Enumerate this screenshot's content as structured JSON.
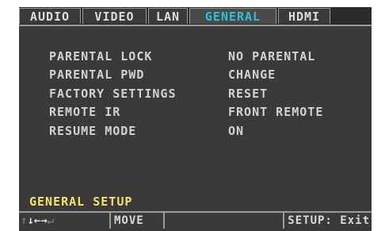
{
  "tabs": [
    {
      "label": "AUDIO"
    },
    {
      "label": "VIDEO"
    },
    {
      "label": "LAN"
    },
    {
      "label": "GENERAL"
    },
    {
      "label": "HDMI"
    }
  ],
  "menu": [
    {
      "label": "PARENTAL LOCK",
      "value": "NO PARENTAL"
    },
    {
      "label": "PARENTAL PWD",
      "value": "CHANGE"
    },
    {
      "label": "FACTORY SETTINGS",
      "value": "RESET"
    },
    {
      "label": "REMOTE IR",
      "value": "FRONT REMOTE"
    },
    {
      "label": "RESUME MODE",
      "value": "ON"
    }
  ],
  "section_title": "GENERAL SETUP",
  "footer": {
    "arrow_icons": [
      "arrow-up-icon",
      "arrow-down-icon",
      "arrow-left-icon",
      "arrow-right-icon",
      "enter-icon"
    ],
    "move_label": "MOVE",
    "exit_label": "SETUP: Exit"
  },
  "colors": {
    "active_tab": "#29c3d6",
    "section_title": "#f5e26a",
    "background": "#3a3a3a"
  }
}
